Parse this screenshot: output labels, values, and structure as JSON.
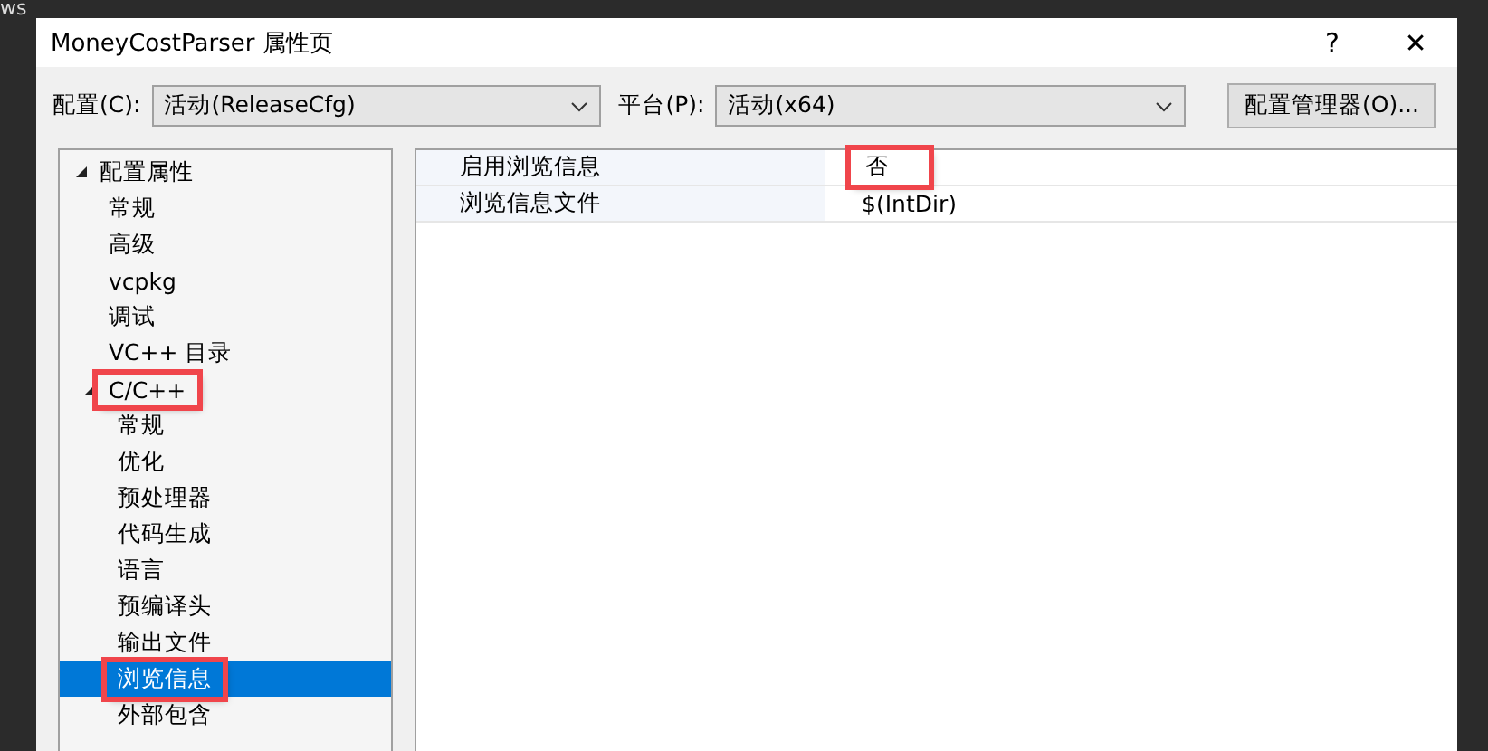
{
  "background": {
    "text": "ws"
  },
  "window": {
    "title": "MoneyCostParser 属性页",
    "help": "?",
    "close": "✕"
  },
  "config": {
    "label": "配置(C):",
    "value": "活动(ReleaseCfg)",
    "platform_label": "平台(P):",
    "platform_value": "活动(x64)",
    "manager_button": "配置管理器(O)..."
  },
  "tree": [
    {
      "label": "配置属性",
      "expanded": true,
      "selected": false,
      "highlighted": false,
      "children": [
        {
          "label": "常规",
          "selected": false,
          "highlighted": false
        },
        {
          "label": "高级",
          "selected": false,
          "highlighted": false
        },
        {
          "label": "vcpkg",
          "selected": false,
          "highlighted": false
        },
        {
          "label": "调试",
          "selected": false,
          "highlighted": false
        },
        {
          "label": "VC++ 目录",
          "selected": false,
          "highlighted": false
        },
        {
          "label": "C/C++",
          "expanded": true,
          "selected": false,
          "highlighted": true,
          "children": [
            {
              "label": "常规",
              "selected": false,
              "highlighted": false
            },
            {
              "label": "优化",
              "selected": false,
              "highlighted": false
            },
            {
              "label": "预处理器",
              "selected": false,
              "highlighted": false
            },
            {
              "label": "代码生成",
              "selected": false,
              "highlighted": false
            },
            {
              "label": "语言",
              "selected": false,
              "highlighted": false
            },
            {
              "label": "预编译头",
              "selected": false,
              "highlighted": false
            },
            {
              "label": "输出文件",
              "selected": false,
              "highlighted": false
            },
            {
              "label": "浏览信息",
              "selected": true,
              "highlighted": true
            },
            {
              "label": "外部包含",
              "selected": false,
              "highlighted": false
            }
          ]
        }
      ]
    }
  ],
  "properties": [
    {
      "name": "启用浏览信息",
      "value": "否",
      "highlighted": true
    },
    {
      "name": "浏览信息文件",
      "value": "$(IntDir)",
      "highlighted": false
    }
  ]
}
